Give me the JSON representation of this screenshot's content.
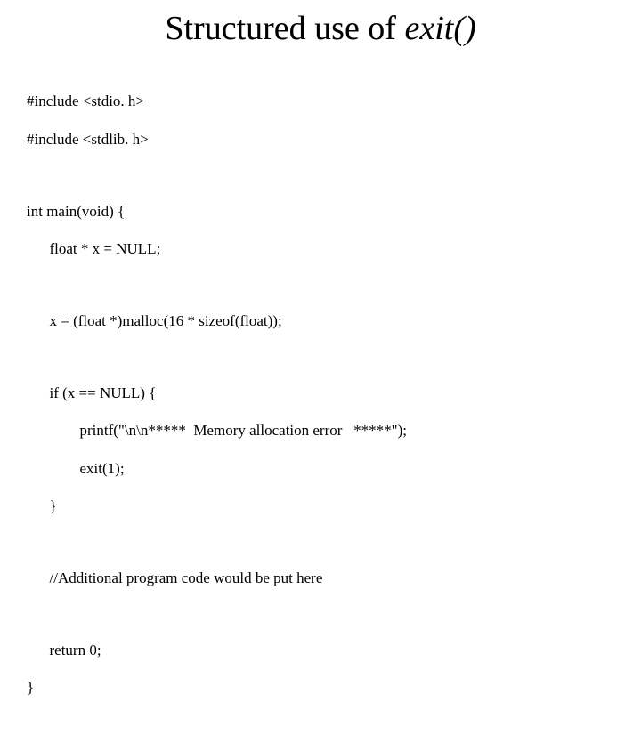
{
  "title_prefix": "Structured use of ",
  "title_italic": "exit()",
  "code": {
    "l1": "#include <stdio. h>",
    "l2": "#include <stdlib. h>",
    "l3": "int main(void) {",
    "l4": "      float * x = NULL;",
    "l5": "      x = (float *)malloc(16 * sizeof(float));",
    "l6": "      if (x == NULL) {",
    "l7": "              printf(\"\\n\\n*****  Memory allocation error   *****\");",
    "l8": "              exit(1);",
    "l9": "      }",
    "l10": "      //Additional program code would be put here",
    "l11": "      return 0;",
    "l12": "}"
  }
}
